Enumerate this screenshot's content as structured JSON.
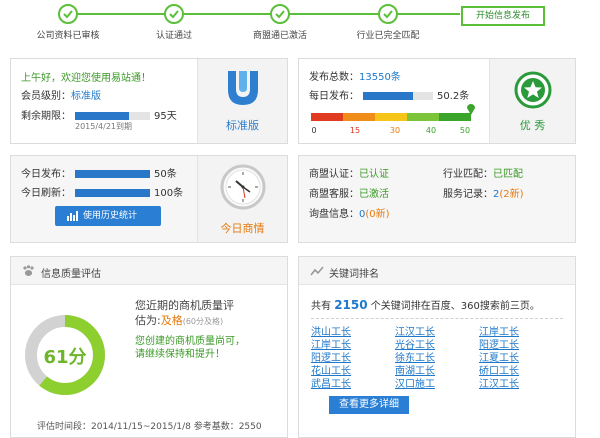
{
  "steps": [
    {
      "label": "公司资料已审核"
    },
    {
      "label": "认证通过"
    },
    {
      "label": "商盟通已激活"
    },
    {
      "label": "行业已完全匹配"
    }
  ],
  "step_final": "开始信息发布",
  "account": {
    "greeting": "上午好，欢迎您使用易站通！",
    "member_label": "会员级别：",
    "member_value": "标准版",
    "remaining_label": "剩余期限：",
    "remaining_value": "95天",
    "remaining_fraction": 0.72,
    "expiry": "2015/4/21到期",
    "edition_label": "标准版"
  },
  "publish": {
    "total_label": "发布总数：",
    "total_value": "13550条",
    "daily_label": "每日发布：",
    "daily_value": "50.2条",
    "daily_fraction": 0.72,
    "gauge_ticks": [
      "0",
      "15",
      "30",
      "40",
      "50"
    ],
    "gauge_value": 50,
    "rating": "优 秀"
  },
  "today": {
    "publish_label": "今日发布：",
    "publish_value": "50条",
    "publish_fraction": 1.0,
    "refresh_label": "今日刷新：",
    "refresh_value": "100条",
    "refresh_fraction": 1.0,
    "history_button": "使用历史统计",
    "today_label": "今日商情"
  },
  "status": {
    "alliance_cert_label": "商盟认证：",
    "alliance_cert_value": "已认证",
    "industry_label": "行业匹配：",
    "industry_value": "已匹配",
    "alliance_service_label": "商盟客服：",
    "alliance_service_value": "已激活",
    "service_record_label": "服务记录：",
    "service_record_count": "2",
    "service_record_new": "(2新)",
    "inquiry_label": "询盘信息：",
    "inquiry_count": "0",
    "inquiry_new": "(0新)"
  },
  "quality": {
    "title": "信息质量评估",
    "message_line1": "您近期的商机质量评",
    "message_line2_prefix": "估为:",
    "message_grade": "及格",
    "message_grade_note": "(60分及格)",
    "advice_line1": "您创建的商机质量尚可，",
    "advice_line2": "请继续保持和提升！",
    "score": "61分",
    "score_value": 61,
    "period": "评估时间段：2014/11/15~2015/1/8   参考基数：2550"
  },
  "keywords": {
    "title": "关键词排名",
    "summary_prefix": "共有",
    "summary_count": "2150",
    "summary_suffix": "个关键词排在百度、360搜索前三页。",
    "items": [
      [
        "洪山工长",
        "江汉工长",
        "江岸工长"
      ],
      [
        "江岸工长",
        "光谷工长",
        "阳逻工长"
      ],
      [
        "阳逻工长",
        "徐东工长",
        "江夏工长"
      ],
      [
        "花山工长",
        "南湖工长",
        "硚口工长"
      ],
      [
        "武昌工长",
        "汉口施工",
        "江汉工长"
      ]
    ],
    "more_button": "查看更多详细"
  },
  "colors": {
    "accent_green": "#5bbf3a",
    "accent_blue": "#2a7fd4",
    "gauge": [
      "#e03b20",
      "#f08c1a",
      "#f5c518",
      "#7cc43a",
      "#3aa52a"
    ]
  }
}
